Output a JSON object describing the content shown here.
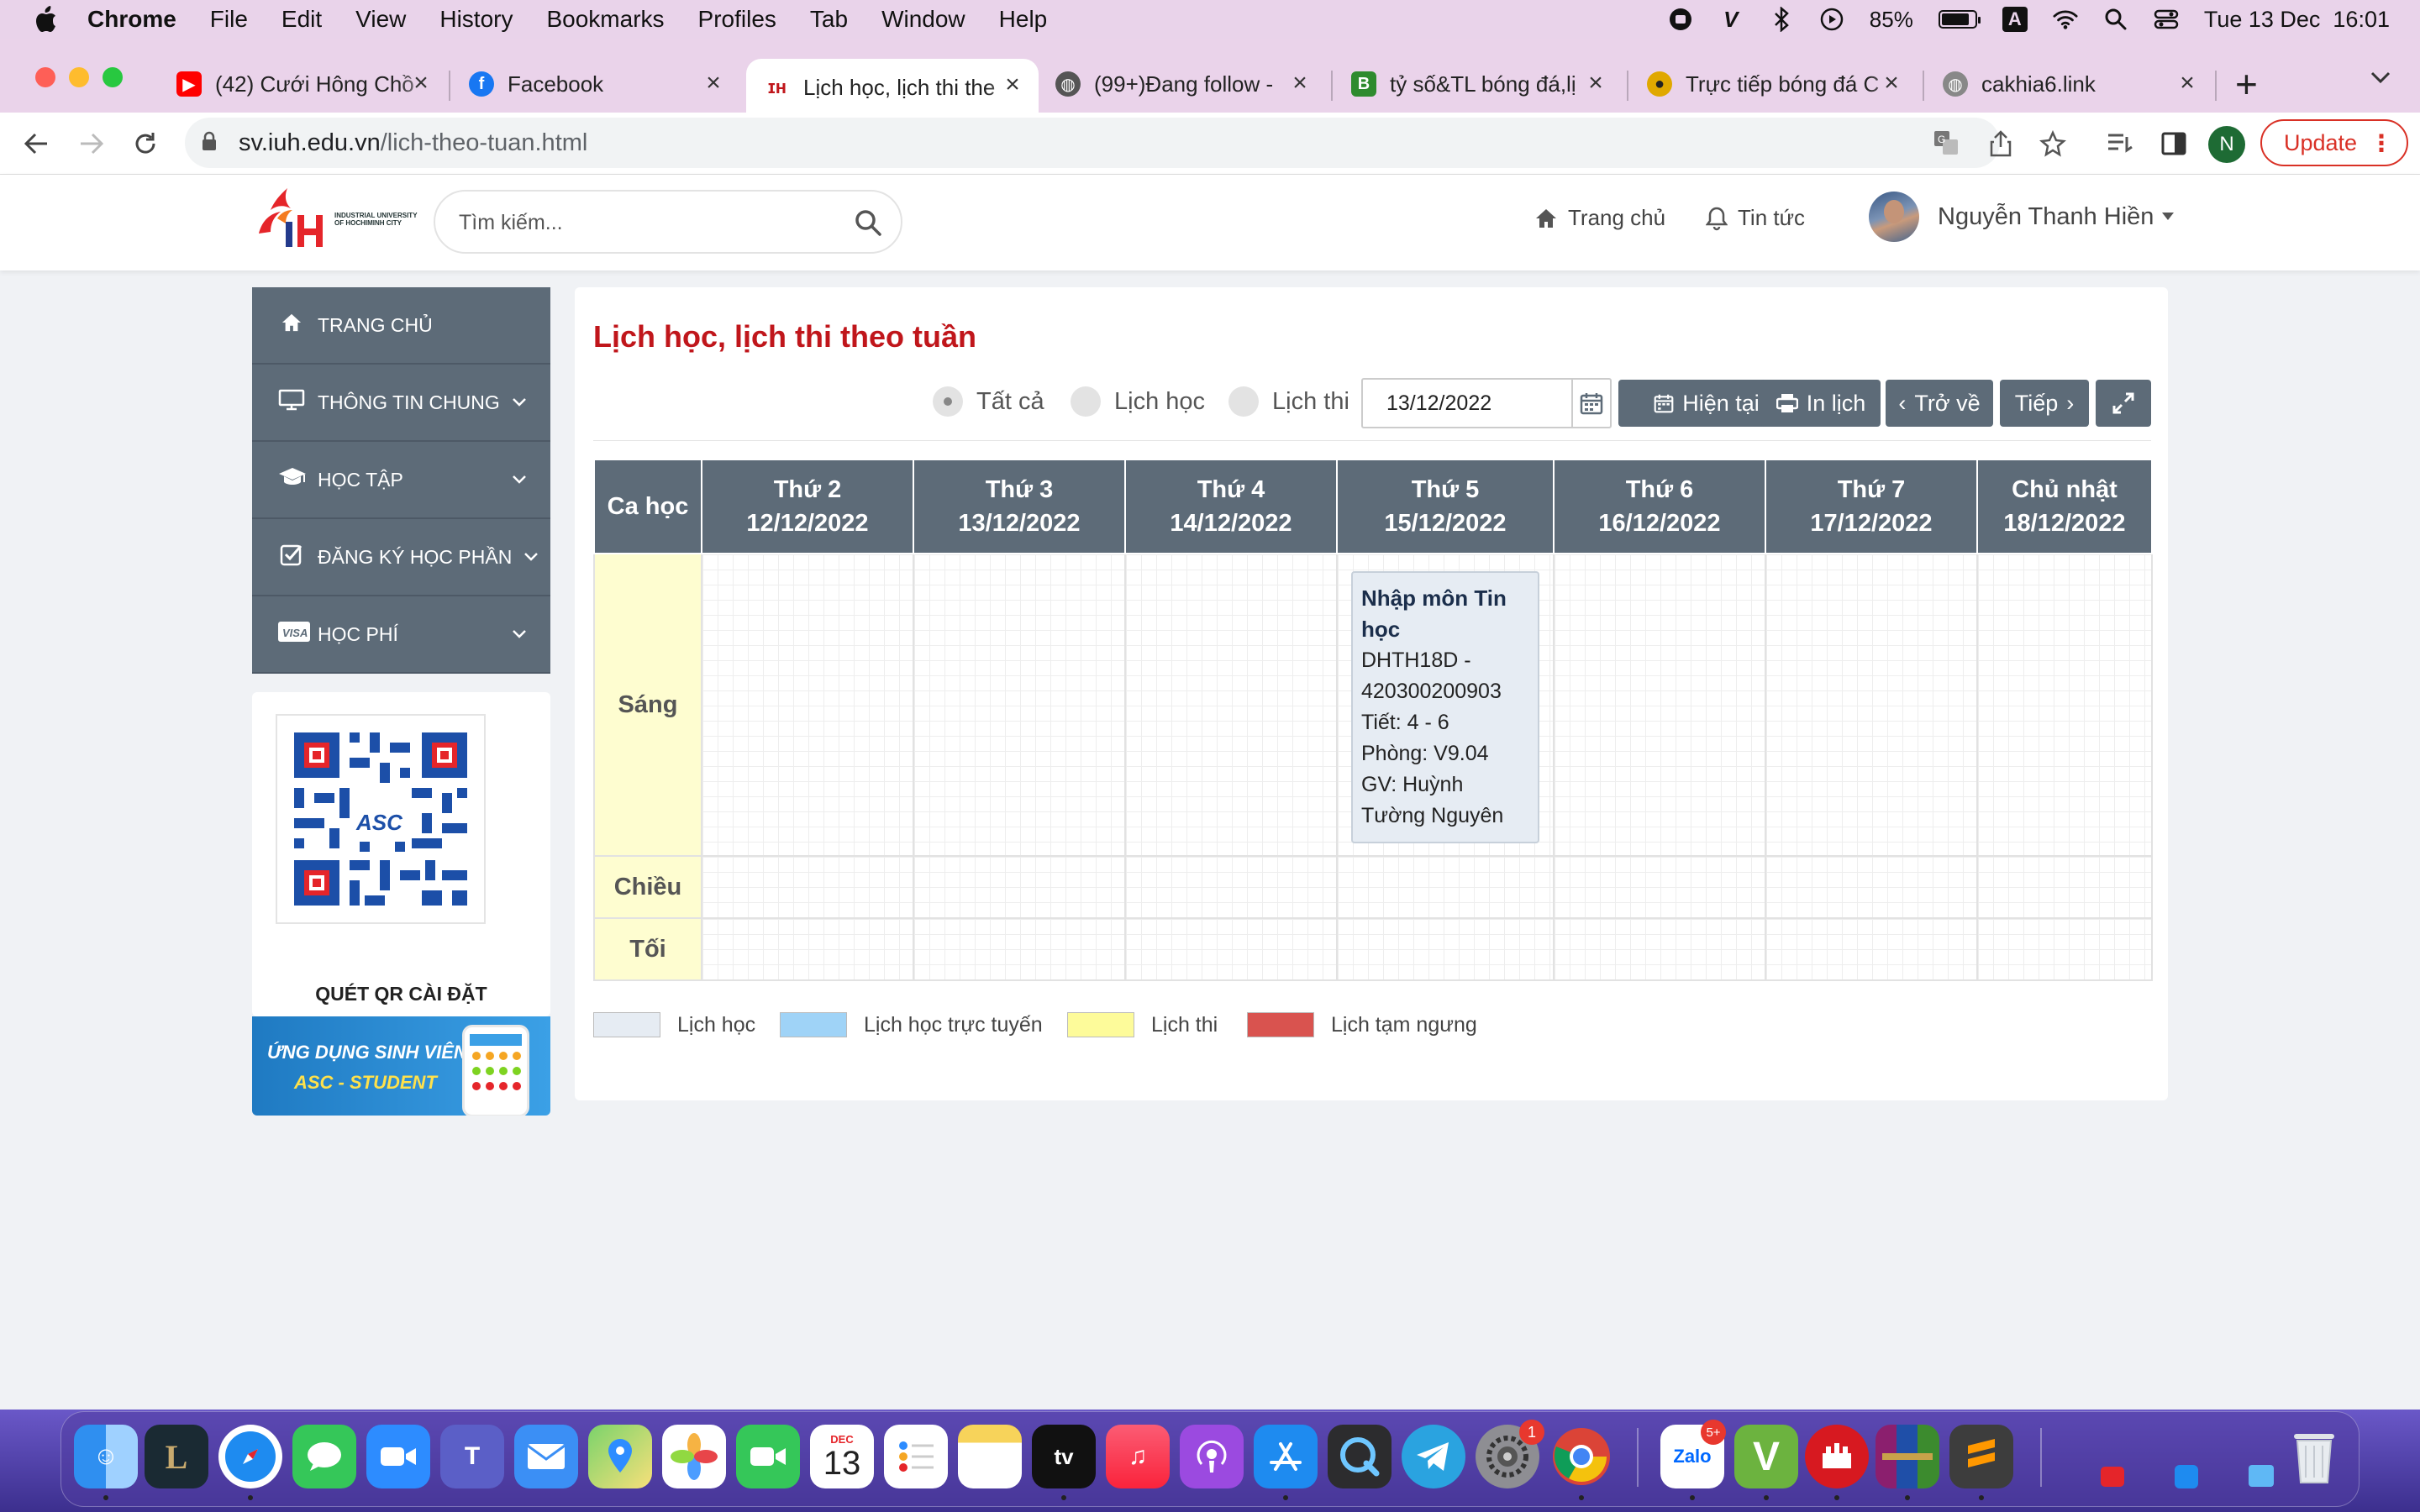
{
  "menubar": {
    "app": "Chrome",
    "items": [
      "File",
      "Edit",
      "View",
      "History",
      "Bookmarks",
      "Profiles",
      "Tab",
      "Window",
      "Help"
    ],
    "battery": "85%",
    "datetime": "Tue 13 Dec  16:01",
    "battery_level": 0.85
  },
  "tabs": [
    {
      "title": "(42) Cưới Hông Chồ",
      "icon": "youtube-icon",
      "color": "#ff0000"
    },
    {
      "title": "Facebook",
      "icon": "facebook-icon",
      "color": "#1877f2"
    },
    {
      "title": "Lịch học, lịch thi the",
      "icon": "iuh-icon",
      "color": "#c0161b",
      "active": true
    },
    {
      "title": "(99+)Đang follow -",
      "icon": "globe-icon",
      "color": "#555555"
    },
    {
      "title": "tỷ số&TL bóng đá,lị",
      "icon": "bongda-icon",
      "color": "#2e8b2e"
    },
    {
      "title": "Trực tiếp bóng đá C",
      "icon": "ball-icon",
      "color": "#e0a800"
    },
    {
      "title": "cakhia6.link",
      "icon": "globe-icon",
      "color": "#888888"
    }
  ],
  "address": {
    "host": "sv.iuh.edu.vn",
    "path": "/lich-theo-tuan.html"
  },
  "update_label": "Update",
  "profile_initial": "N",
  "header": {
    "logo_text": "INDUSTRIAL UNIVERSITY OF HOCHIMINH CITY",
    "search_placeholder": "Tìm kiếm...",
    "home": "Trang chủ",
    "news": "Tin tức",
    "user": "Nguyễn Thanh Hiền"
  },
  "sidebar": {
    "items": [
      {
        "label": "TRANG CHỦ",
        "icon": "home-icon"
      },
      {
        "label": "THÔNG TIN CHUNG",
        "icon": "monitor-icon"
      },
      {
        "label": "HỌC TẬP",
        "icon": "graduation-cap-icon"
      },
      {
        "label": "ĐĂNG KÝ HỌC PHẦN",
        "icon": "checkbox-icon"
      },
      {
        "label": "HỌC PHÍ",
        "icon": "visa-card-icon"
      }
    ],
    "qr_logo": "ASC",
    "qr_caption": "QUÉT QR CÀI ĐẶT",
    "banner_line1": "ỨNG DỤNG SINH VIÊN",
    "banner_line2": "ASC - STUDENT"
  },
  "page": {
    "title": "Lịch học, lịch thi theo tuần",
    "filters": [
      {
        "label": "Tất cả",
        "checked": true
      },
      {
        "label": "Lịch học",
        "checked": false
      },
      {
        "label": "Lịch thi",
        "checked": false
      }
    ],
    "date": "13/12/2022",
    "buttons": {
      "current": "Hiện tại",
      "print": "In lịch",
      "back": "Trở về",
      "next": "Tiếp"
    }
  },
  "schedule": {
    "shift_header": "Ca học",
    "days": [
      {
        "name": "Thứ 2",
        "date": "12/12/2022"
      },
      {
        "name": "Thứ 3",
        "date": "13/12/2022"
      },
      {
        "name": "Thứ 4",
        "date": "14/12/2022"
      },
      {
        "name": "Thứ 5",
        "date": "15/12/2022"
      },
      {
        "name": "Thứ 6",
        "date": "16/12/2022"
      },
      {
        "name": "Thứ 7",
        "date": "17/12/2022"
      },
      {
        "name": "Chủ nhật",
        "date": "18/12/2022"
      }
    ],
    "shifts": [
      "Sáng",
      "Chiều",
      "Tối"
    ],
    "entry": {
      "name": "Nhập môn Tin học",
      "code": "DHTH18D - 420300200903",
      "period": "Tiết: 4 - 6",
      "room": "Phòng: V9.04",
      "teacher": "GV: Huỳnh Tường Nguyên"
    }
  },
  "legend": [
    {
      "label": "Lịch học",
      "color": "#e6ecf3"
    },
    {
      "label": "Lịch học trực tuyến",
      "color": "#9fd3f7"
    },
    {
      "label": "Lịch thi",
      "color": "#fdfb9a"
    },
    {
      "label": "Lịch tạm ngưng",
      "color": "#d9534f"
    }
  ],
  "dock": {
    "calendar_month": "DEC",
    "calendar_day": "13",
    "settings_badge": "1",
    "zalo_badge": "5+",
    "zalo_label": "Zalo",
    "tv_label": "tv"
  }
}
